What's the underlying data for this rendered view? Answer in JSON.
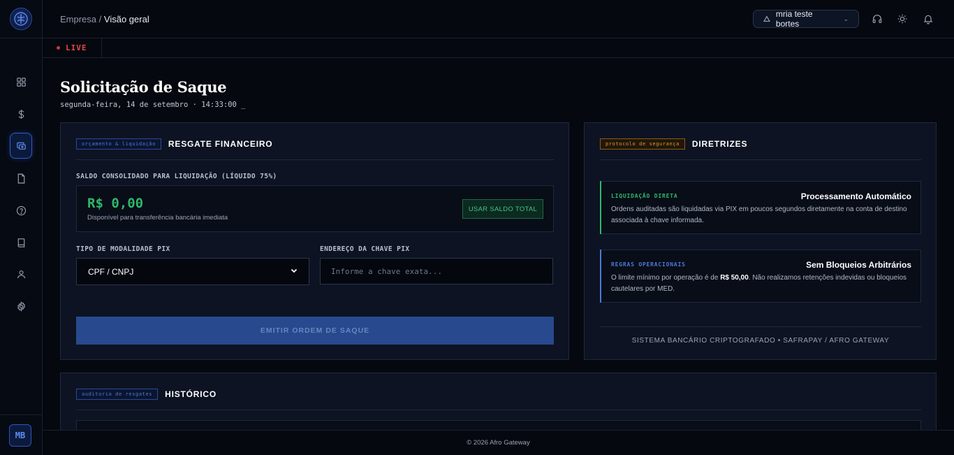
{
  "breadcrumb": {
    "parent": "Empresa",
    "separator": "/",
    "current": "Visão geral"
  },
  "user": {
    "name": "mria teste bortes",
    "initials": "MB"
  },
  "live_label": "LIVE",
  "page": {
    "title": "Solicitação de Saque",
    "datetime": "segunda-feira, 14 de setembro · 14:33:00 _"
  },
  "withdraw": {
    "tag": "orçamento & liquidação",
    "title": "RESGATE FINANCEIRO",
    "balance_label": "SALDO CONSOLIDADO PARA LIQUIDAÇÃO (LÍQUIDO 75%)",
    "balance_value": "R$ 0,00",
    "balance_note": "Disponível para transferência bancária imediata",
    "use_total_label": "USAR SALDO TOTAL",
    "pix_type_label": "TIPO DE MODALIDADE PIX",
    "pix_type_value": "CPF / CNPJ",
    "pix_key_label": "ENDEREÇO DA CHAVE PIX",
    "pix_key_placeholder": "Informe a chave exata...",
    "submit_label": "EMITIR ORDEM DE SAQUE"
  },
  "guidelines": {
    "tag": "protocolo de segurança",
    "title": "DIRETRIZES",
    "rules": [
      {
        "tag": "LIQUIDAÇÃO DIRETA",
        "title": "Processamento Automático",
        "text": "Ordens auditadas são liquidadas via PIX em poucos segundos diretamente na conta de destino associada à chave informada.",
        "accent": "#2fb86a"
      },
      {
        "tag": "REGRAS OPERACIONAIS",
        "title": "Sem Bloqueios Arbitrários",
        "text_before": "O limite mínimo por operação é de ",
        "text_bold": "R$ 50,00",
        "text_after": ". Não realizamos retenções indevidas ou bloqueios cautelares por MED.",
        "accent": "#4e79d8"
      }
    ],
    "footer": "SISTEMA BANCÁRIO CRIPTOGRAFADO • SAFRAPAY / AFRO GATEWAY"
  },
  "history": {
    "tag": "auditoria de resgates",
    "title": "HISTÓRICO"
  },
  "footer": "© 2026 Afro Gateway",
  "colors": {
    "accent_blue": "#2d5bd0",
    "success_green": "#2fb86a",
    "live_red": "#e04848",
    "warning_orange": "#d89a3c"
  },
  "icons": {
    "sidebar": [
      "dashboard-grid-icon",
      "dollar-icon",
      "withdraw-icon",
      "document-icon",
      "help-circle-icon",
      "book-icon",
      "user-icon",
      "settings-gear-icon"
    ],
    "header": [
      "headphones-icon",
      "sun-icon",
      "bell-icon"
    ]
  }
}
